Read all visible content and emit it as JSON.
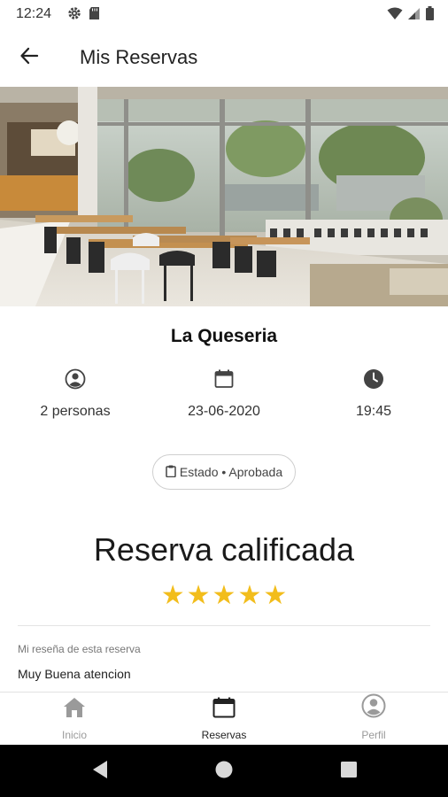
{
  "status_bar": {
    "time": "12:24",
    "icons_left": [
      "gear-icon",
      "sd-card-icon"
    ],
    "icons_right": [
      "wifi-icon",
      "signal-icon",
      "battery-icon"
    ]
  },
  "app_bar": {
    "back_icon": "arrow-left-icon",
    "title": "Mis Reservas"
  },
  "reservation": {
    "restaurant_name": "La Queseria",
    "people": "2 personas",
    "date": "23-06-2020",
    "time": "19:45",
    "status": "Estado • Aprobada"
  },
  "rating": {
    "title": "Reserva calificada",
    "stars": 5,
    "star_color": "#f2bd1c"
  },
  "review": {
    "label": "Mi reseña de esta reserva",
    "text": "Muy Buena atencion"
  },
  "bottom_nav": {
    "items": [
      {
        "label": "Inicio",
        "icon": "home-icon"
      },
      {
        "label": "Reservas",
        "icon": "calendar-icon"
      },
      {
        "label": "Perfil",
        "icon": "user-icon"
      }
    ],
    "active_index": 1
  },
  "system_nav": {
    "buttons": [
      "back-triangle-icon",
      "home-circle-icon",
      "recents-square-icon"
    ]
  }
}
